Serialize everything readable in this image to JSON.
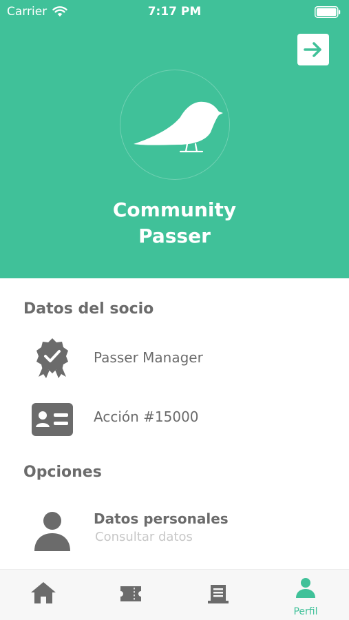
{
  "status_bar": {
    "carrier": "Carrier",
    "time": "7:17 PM"
  },
  "header": {
    "community_name_line1": "Community",
    "community_name_line2": "Passer"
  },
  "member_data": {
    "title": "Datos del socio",
    "items": [
      {
        "icon": "badge-check-icon",
        "label": "Passer Manager"
      },
      {
        "icon": "id-card-icon",
        "label": "Acción #15000"
      }
    ]
  },
  "options": {
    "title": "Opciones",
    "items": [
      {
        "icon": "user-icon",
        "label": "Datos personales",
        "sublabel": "Consultar datos"
      }
    ]
  },
  "tabbar": {
    "tabs": [
      {
        "icon": "home-icon",
        "label": ""
      },
      {
        "icon": "ticket-icon",
        "label": ""
      },
      {
        "icon": "receipt-icon",
        "label": ""
      },
      {
        "icon": "profile-icon",
        "label": "Perfil",
        "active": true
      }
    ]
  },
  "colors": {
    "accent": "#40c199",
    "text": "#6b6b6b",
    "subtext": "#c7c7c7",
    "icon": "#6b6b6b"
  }
}
